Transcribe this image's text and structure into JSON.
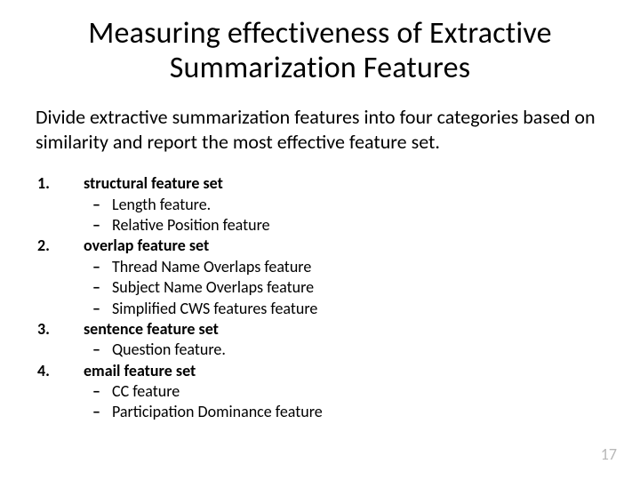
{
  "title": "Measuring effectiveness of  Extractive Summarization Features",
  "intro": "Divide extractive summarization features into four categories based on similarity and report the most effective feature set.",
  "categories": [
    {
      "name": "structural feature set",
      "items": [
        "Length feature.",
        "Relative Position feature"
      ]
    },
    {
      "name": "overlap feature set",
      "items": [
        "Thread Name Overlaps feature",
        "Subject Name Overlaps feature",
        "Simplified CWS features feature"
      ]
    },
    {
      "name": "sentence feature set",
      "items": [
        "Question feature."
      ]
    },
    {
      "name": "email feature set",
      "items": [
        "CC feature",
        "Participation Dominance feature"
      ]
    }
  ],
  "page_number": "17"
}
